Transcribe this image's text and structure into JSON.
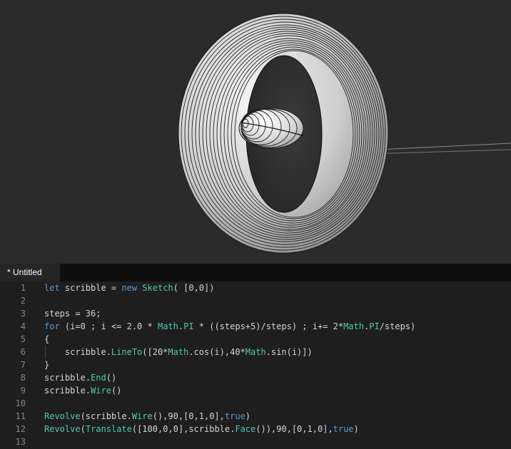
{
  "tab": {
    "label": "* Untitled"
  },
  "editor": {
    "lines": [
      {
        "n": "1",
        "tokens": [
          [
            "kw",
            "let"
          ],
          [
            "id",
            " scribble = "
          ],
          [
            "kw",
            "new"
          ],
          [
            "id",
            " "
          ],
          [
            "fn",
            "Sketch"
          ],
          [
            "id",
            "( [0,0])"
          ]
        ]
      },
      {
        "n": "2",
        "tokens": []
      },
      {
        "n": "3",
        "tokens": [
          [
            "id",
            "steps = 36;"
          ]
        ]
      },
      {
        "n": "4",
        "tokens": [
          [
            "kw",
            "for"
          ],
          [
            "id",
            " (i=0 ; i <= 2.0 * "
          ],
          [
            "fn",
            "Math"
          ],
          [
            "id",
            "."
          ],
          [
            "fn",
            "PI"
          ],
          [
            "id",
            " * ((steps+5)/steps) ; i+= 2*"
          ],
          [
            "fn",
            "Math"
          ],
          [
            "id",
            "."
          ],
          [
            "fn",
            "PI"
          ],
          [
            "id",
            "/steps)"
          ]
        ]
      },
      {
        "n": "5",
        "tokens": [
          [
            "id",
            "{"
          ]
        ]
      },
      {
        "n": "6",
        "tokens": [
          [
            "id",
            "    scribble."
          ],
          [
            "fn",
            "LineTo"
          ],
          [
            "id",
            "([20*"
          ],
          [
            "fn",
            "Math"
          ],
          [
            "id",
            ".cos(i),40*"
          ],
          [
            "fn",
            "Math"
          ],
          [
            "id",
            ".sin(i)])"
          ]
        ]
      },
      {
        "n": "7",
        "tokens": [
          [
            "id",
            "}"
          ]
        ]
      },
      {
        "n": "8",
        "tokens": [
          [
            "id",
            "scribble."
          ],
          [
            "fn",
            "End"
          ],
          [
            "id",
            "()"
          ]
        ]
      },
      {
        "n": "9",
        "tokens": [
          [
            "id",
            "scribble."
          ],
          [
            "fn",
            "Wire"
          ],
          [
            "id",
            "()"
          ]
        ]
      },
      {
        "n": "10",
        "tokens": []
      },
      {
        "n": "11",
        "tokens": [
          [
            "fn",
            "Revolve"
          ],
          [
            "id",
            "(scribble."
          ],
          [
            "fn",
            "Wire"
          ],
          [
            "id",
            "(),90,[0,1,0],"
          ],
          [
            "kw",
            "true"
          ],
          [
            "id",
            ")"
          ]
        ]
      },
      {
        "n": "12",
        "tokens": [
          [
            "fn",
            "Revolve"
          ],
          [
            "id",
            "("
          ],
          [
            "fn",
            "Translate"
          ],
          [
            "id",
            "([100,0,0],scribble."
          ],
          [
            "fn",
            "Face"
          ],
          [
            "id",
            "()),90,[0,1,0],"
          ],
          [
            "kw",
            "true"
          ],
          [
            "id",
            ")"
          ]
        ]
      },
      {
        "n": "13",
        "tokens": []
      }
    ]
  },
  "colors": {
    "viewport_bg": "#2b2b2b",
    "editor_bg": "#1e1e1e",
    "keyword": "#569cd6",
    "function": "#4ec9b0",
    "identifier": "#d4d4d4",
    "line_number": "#858585"
  }
}
